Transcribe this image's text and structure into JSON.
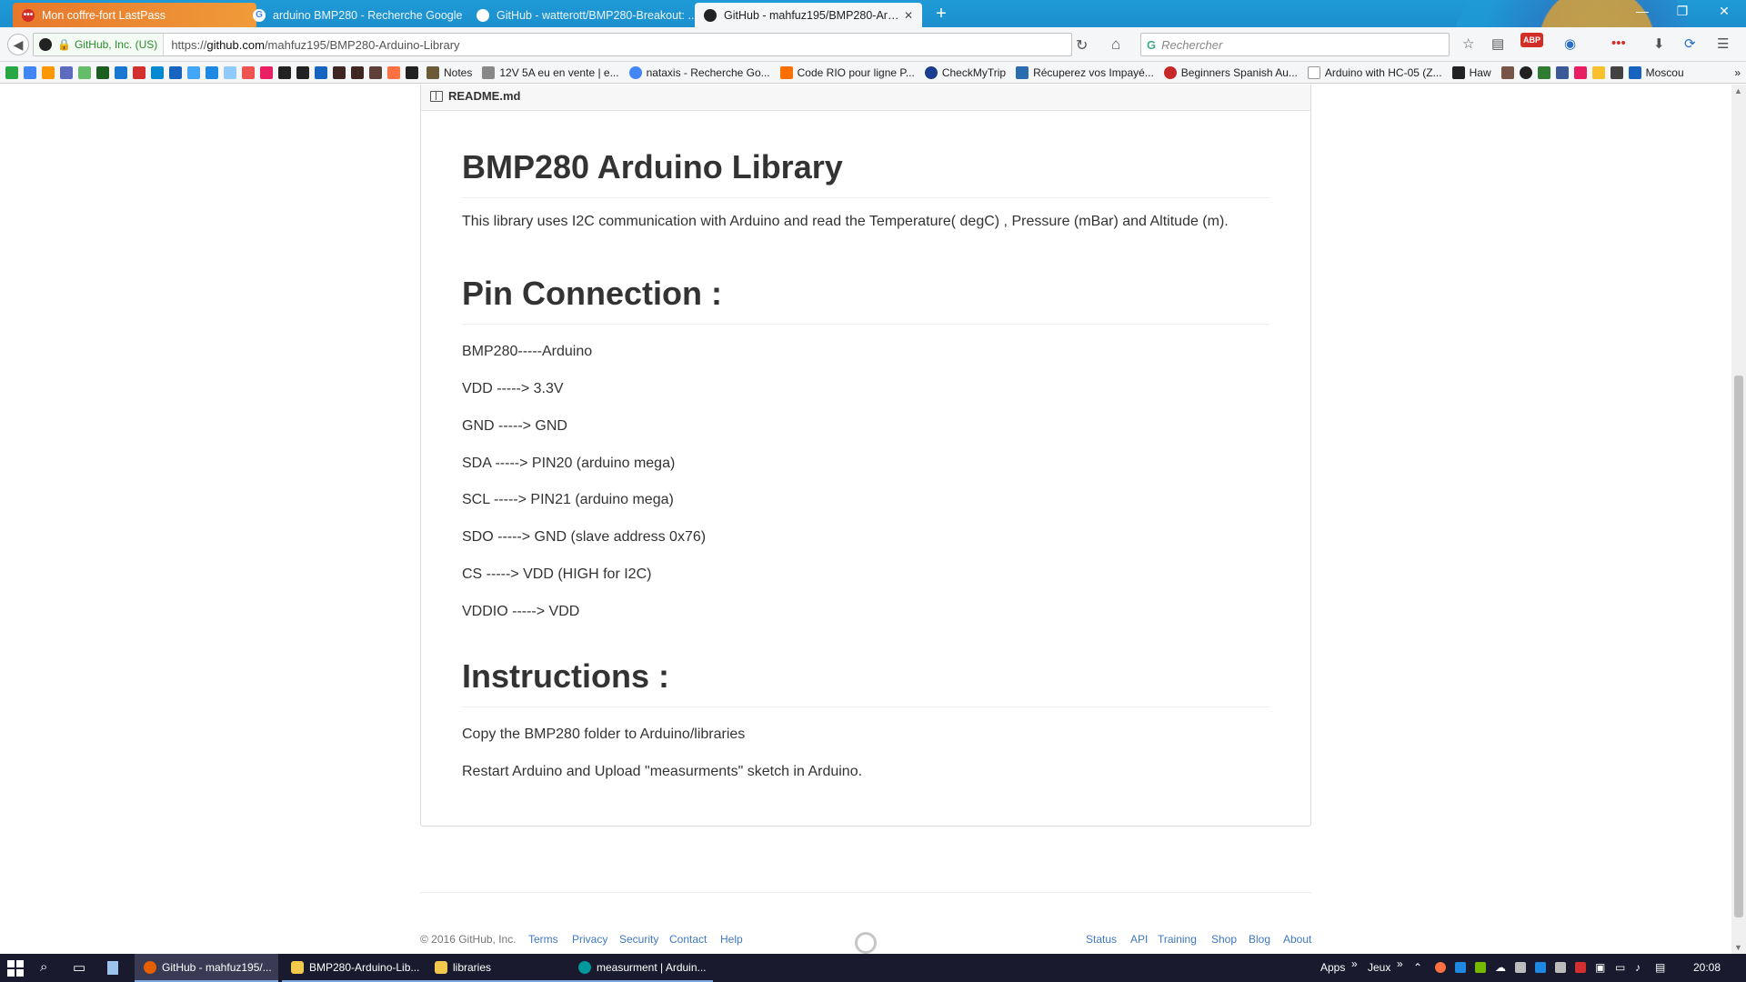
{
  "browser": {
    "tabs": [
      {
        "title": "Mon coffre-fort LastPass",
        "icon": "lastpass-icon"
      },
      {
        "title": "arduino BMP280 - Recherche Google",
        "icon": "google-icon"
      },
      {
        "title": "GitHub - watterott/BMP280-Breakout: ...",
        "icon": "github-icon"
      },
      {
        "title": "GitHub - mahfuz195/BMP280-Arduino...",
        "icon": "github-icon"
      }
    ],
    "identity_label": "GitHub, Inc. (US)",
    "url_prefix": "https://",
    "url_host": "github.com",
    "url_path": "/mahfuz195/BMP280-Arduino-Library",
    "search_placeholder": "Rechercher",
    "search_engine_glyph": "G",
    "adblock_label": "ABP"
  },
  "bookmarks": [
    {
      "label": "Notes",
      "color": "#6b5b3a"
    },
    {
      "label": "12V 5A eu en vente | e...",
      "color": "#888888"
    },
    {
      "label": "nataxis - Recherche Go...",
      "color": "#4285f4"
    },
    {
      "label": "Code RIO pour ligne P...",
      "color": "#ff6f00"
    },
    {
      "label": "CheckMyTrip",
      "color": "#1b3f8f"
    },
    {
      "label": "Récuperez vos Impayé...",
      "color": "#2d6bb0"
    },
    {
      "label": "Beginners Spanish Au...",
      "color": "#c62828"
    },
    {
      "label": "Arduino with HC-05 (Z...",
      "color": "#dddddd"
    },
    {
      "label": "Haw",
      "color": "#222222"
    },
    {
      "label": "Moscou",
      "color": "#1565c0"
    }
  ],
  "readme": {
    "file_name": "README.md",
    "title": "BMP280 Arduino Library",
    "intro": "This library uses I2C communication with Arduino and read the Temperature( degC) , Pressure (mBar) and Altitude (m).",
    "pin_heading": "Pin Connection :",
    "pins": [
      "BMP280-----Arduino",
      "VDD -----> 3.3V",
      "GND -----> GND",
      "SDA -----> PIN20 (arduino mega)",
      "SCL -----> PIN21 (arduino mega)",
      "SDO -----> GND (slave address 0x76)",
      "CS -----> VDD (HIGH for I2C)",
      "VDDIO -----> VDD"
    ],
    "instructions_heading": "Instructions :",
    "instructions": [
      "Copy the BMP280 folder to Arduino/libraries",
      "Restart Arduino and Upload \"measurments\" sketch in Arduino."
    ]
  },
  "footer": {
    "copyright": "© 2016 GitHub, Inc.",
    "left_links": [
      "Terms",
      "Privacy",
      "Security",
      "Contact",
      "Help"
    ],
    "right_links": [
      "Status",
      "API",
      "Training",
      "Shop",
      "Blog",
      "About"
    ]
  },
  "taskbar": {
    "tasks": [
      {
        "label": "GitHub - mahfuz195/...",
        "color": "#e66000"
      },
      {
        "label": "BMP280-Arduino-Lib...",
        "color": "#f2c94c"
      },
      {
        "label": "libraries",
        "color": "#f2c94c"
      },
      {
        "label": "measurment | Arduin...",
        "color": "#00979d"
      }
    ],
    "apps_label": "Apps",
    "jeux_label": "Jeux",
    "time": "20:08"
  },
  "colors": {
    "tab_strip": "#1f9ad6",
    "link": "#4078c0",
    "taskbar": "#1a1a2e"
  }
}
